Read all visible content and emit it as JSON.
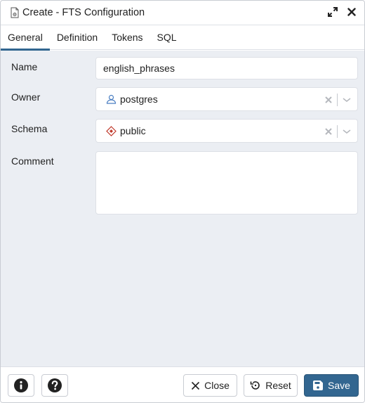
{
  "dialog": {
    "title": "Create - FTS Configuration",
    "icons": {
      "title": "fts-configuration-icon",
      "maximize": "maximize-icon",
      "close": "close-icon"
    }
  },
  "tabs": [
    {
      "label": "General",
      "active": true
    },
    {
      "label": "Definition",
      "active": false
    },
    {
      "label": "Tokens",
      "active": false
    },
    {
      "label": "SQL",
      "active": false
    }
  ],
  "form": {
    "name": {
      "label": "Name",
      "value": "english_phrases"
    },
    "owner": {
      "label": "Owner",
      "value": "postgres",
      "icon": "user-icon"
    },
    "schema": {
      "label": "Schema",
      "value": "public",
      "icon": "schema-icon"
    },
    "comment": {
      "label": "Comment",
      "value": ""
    }
  },
  "footer": {
    "info_icon": "info-icon",
    "help_icon": "help-icon",
    "close_label": "Close",
    "reset_label": "Reset",
    "save_label": "Save"
  },
  "colors": {
    "primary": "#326690",
    "background": "#ebeef3",
    "border": "#dde0e6"
  }
}
